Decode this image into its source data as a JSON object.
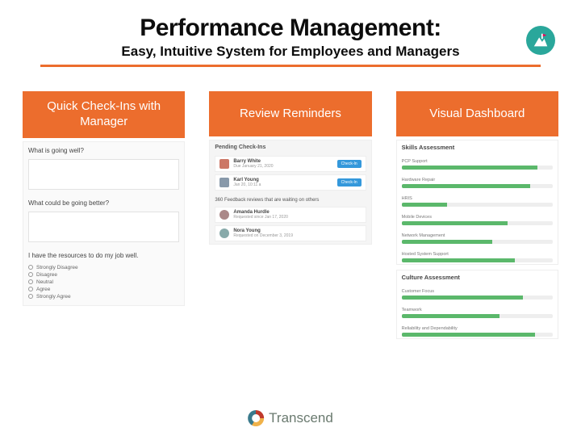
{
  "header": {
    "title": "Performance Management:",
    "subtitle": "Easy, Intuitive System for Employees and Managers"
  },
  "columns": [
    {
      "title": "Quick Check-Ins with Manager"
    },
    {
      "title": "Review Reminders"
    },
    {
      "title": "Visual Dashboard"
    }
  ],
  "col1": {
    "q1": "What is going well?",
    "q2": "What could be going better?",
    "q3": "I have the resources to do my job well.",
    "options": [
      "Strongly Disagree",
      "Disagree",
      "Neutral",
      "Agree",
      "Strongly Agree"
    ]
  },
  "col2": {
    "pending_title": "Pending Check-Ins",
    "cards": [
      {
        "name": "Barry White",
        "meta": "Due January 21, 2020",
        "btn": "Check-In"
      },
      {
        "name": "Karl Young",
        "meta": "Jan 20, 10:11 a",
        "btn": "Check-In"
      }
    ],
    "fb_title": "360 Feedback reviews that are waiting on others",
    "fb": [
      {
        "name": "Amanda Hurdle",
        "meta": "Requested since Jan 17, 2020"
      },
      {
        "name": "Nora Young",
        "meta": "Requested on December 3, 2019"
      }
    ]
  },
  "col3": {
    "skills_title": "Skills Assessment",
    "skills": [
      {
        "label": "PCP Support",
        "pct": 90
      },
      {
        "label": "Hardware Repair",
        "pct": 85
      },
      {
        "label": "HRIS",
        "pct": 30
      },
      {
        "label": "Mobile Devices",
        "pct": 70
      },
      {
        "label": "Network Management",
        "pct": 60
      },
      {
        "label": "Hosted System Support",
        "pct": 75
      }
    ],
    "culture_title": "Culture Assessment",
    "culture": [
      {
        "label": "Customer Focus",
        "pct": 80
      },
      {
        "label": "Teamwork",
        "pct": 65
      },
      {
        "label": "Reliability and Dependability",
        "pct": 88
      }
    ]
  },
  "footer": {
    "brand": "Transcend"
  }
}
